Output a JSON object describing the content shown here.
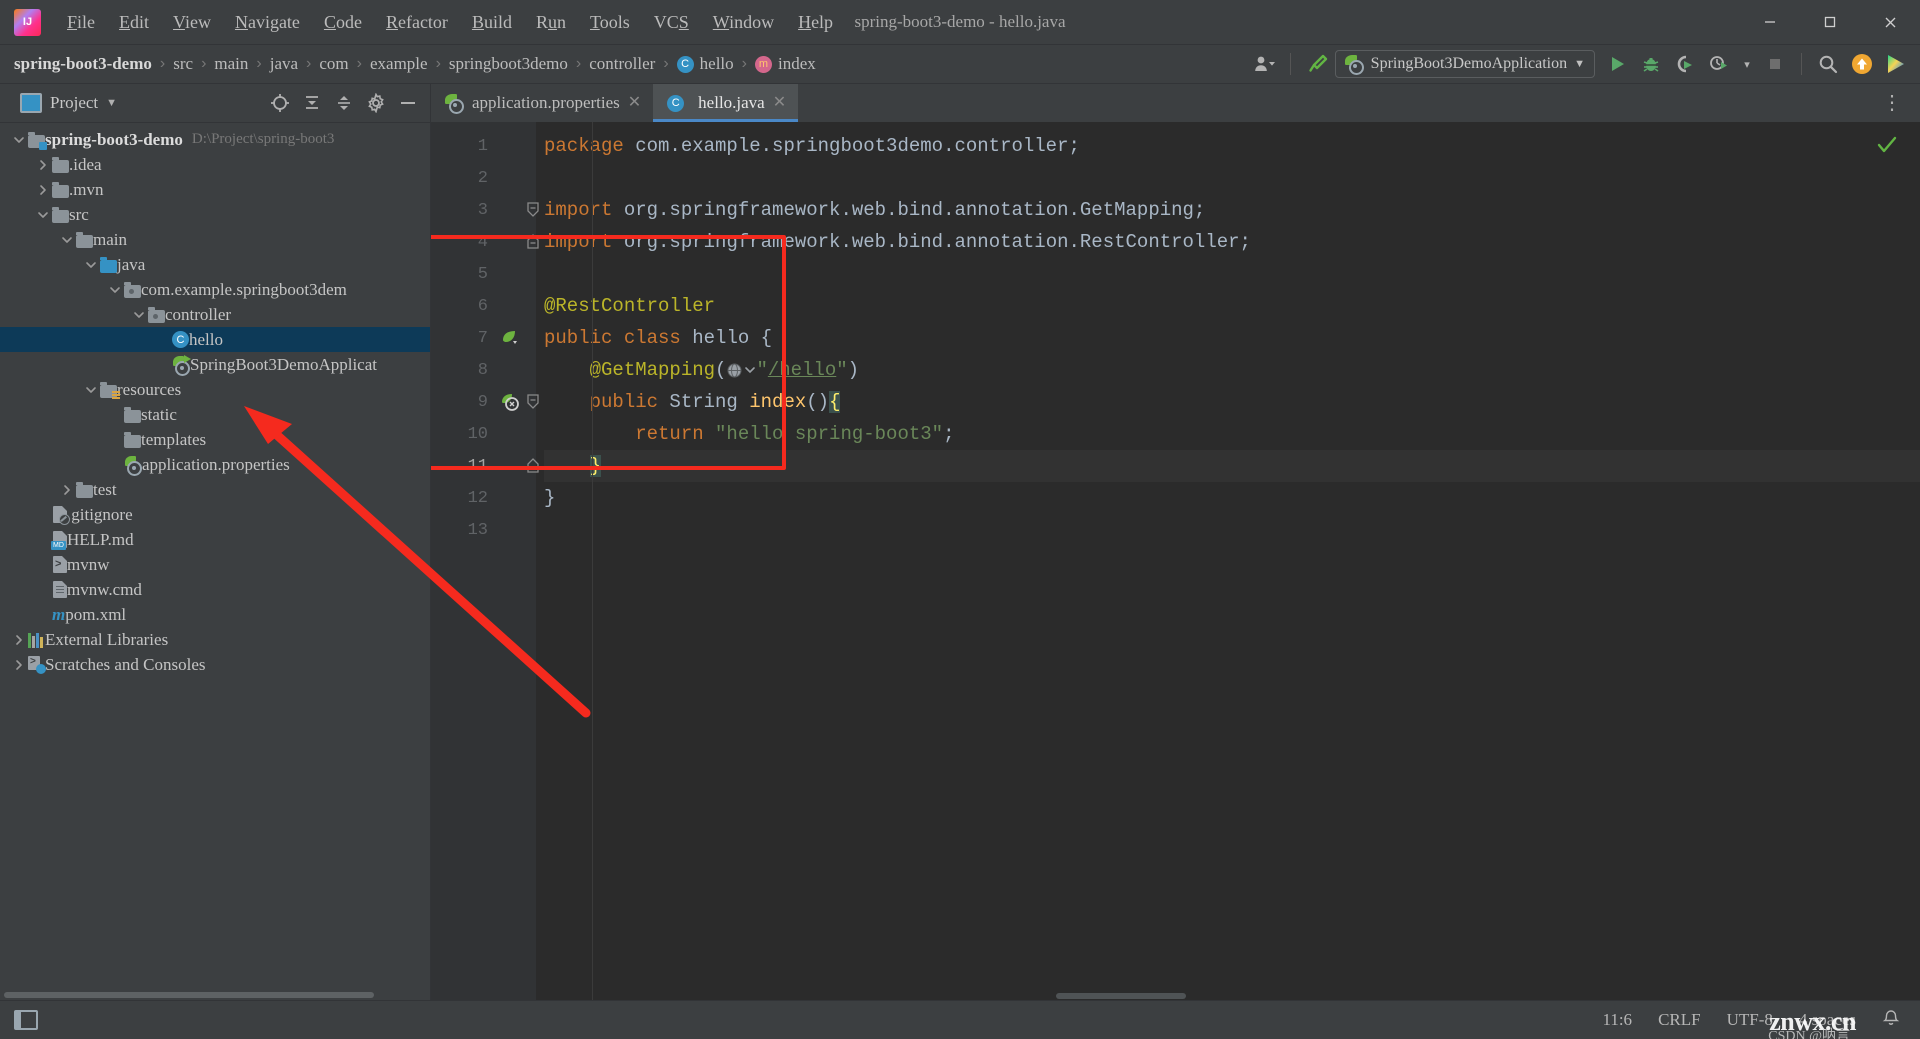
{
  "window": {
    "title": "spring-boot3-demo - hello.java",
    "logo_icon": "intellij-idea-logo",
    "minimize_label": "—",
    "maximize_label": "❐",
    "close_label": "✕"
  },
  "menubar": {
    "items": [
      {
        "label": "File",
        "mnemonic": "F"
      },
      {
        "label": "Edit",
        "mnemonic": "E"
      },
      {
        "label": "View",
        "mnemonic": "V"
      },
      {
        "label": "Navigate",
        "mnemonic": "N"
      },
      {
        "label": "Code",
        "mnemonic": "C"
      },
      {
        "label": "Refactor",
        "mnemonic": "R"
      },
      {
        "label": "Build",
        "mnemonic": "B"
      },
      {
        "label": "Run",
        "mnemonic": "u"
      },
      {
        "label": "Tools",
        "mnemonic": "T"
      },
      {
        "label": "VCS",
        "mnemonic": "S"
      },
      {
        "label": "Window",
        "mnemonic": "W"
      },
      {
        "label": "Help",
        "mnemonic": "H"
      }
    ]
  },
  "breadcrumb": {
    "separator": "›",
    "items": [
      {
        "label": "spring-boot3-demo",
        "icon": "none",
        "root": true
      },
      {
        "label": "src",
        "icon": "none"
      },
      {
        "label": "main",
        "icon": "none"
      },
      {
        "label": "java",
        "icon": "none"
      },
      {
        "label": "com",
        "icon": "none"
      },
      {
        "label": "example",
        "icon": "none"
      },
      {
        "label": "springboot3demo",
        "icon": "none"
      },
      {
        "label": "controller",
        "icon": "none"
      },
      {
        "label": "hello",
        "icon": "class-icon",
        "icon_letter": "C"
      },
      {
        "label": "index",
        "icon": "method-icon",
        "icon_letter": "m"
      }
    ]
  },
  "toolbar": {
    "account_icon": "user-account-icon",
    "build_icon": "build-hammer-icon",
    "run_config": {
      "icon": "spring-boot-icon",
      "label": "SpringBoot3DemoApplication",
      "chevron": "▼"
    },
    "run_icon": "run-play-icon",
    "debug_icon": "debug-bug-icon",
    "run_coverage_icon": "run-with-coverage-icon",
    "profiler_icon": "profiler-icon",
    "profiler_chevron": "▾",
    "stop_icon": "stop-square-icon",
    "search_icon": "search-everywhere-icon",
    "update_icon": "update-available-icon",
    "ai_icon": "ide-features-trainer-icon"
  },
  "sidebar": {
    "title": "Project",
    "title_chevron": "▼",
    "actions": [
      {
        "name": "select-opened-file-icon",
        "glyph": "⊕"
      },
      {
        "name": "expand-all-icon",
        "glyph": "⥣"
      },
      {
        "name": "collapse-all-icon",
        "glyph": "⥤"
      },
      {
        "name": "settings-gear-icon",
        "glyph": "⚙"
      },
      {
        "name": "hide-panel-icon",
        "glyph": "—"
      }
    ],
    "tree": [
      {
        "label": "spring-boot3-demo",
        "sub": "D:\\Project\\spring-boot3",
        "depth": 0,
        "twisty": "down",
        "icon": "module-folder-icon",
        "bold": true,
        "selected": false
      },
      {
        "label": ".idea",
        "sub": "",
        "depth": 1,
        "twisty": "right",
        "icon": "folder-icon",
        "bold": false,
        "selected": false
      },
      {
        "label": ".mvn",
        "sub": "",
        "depth": 1,
        "twisty": "right",
        "icon": "folder-icon",
        "bold": false,
        "selected": false
      },
      {
        "label": "src",
        "sub": "",
        "depth": 1,
        "twisty": "down",
        "icon": "folder-icon",
        "bold": false,
        "selected": false
      },
      {
        "label": "main",
        "sub": "",
        "depth": 2,
        "twisty": "down",
        "icon": "folder-icon",
        "bold": false,
        "selected": false
      },
      {
        "label": "java",
        "sub": "",
        "depth": 3,
        "twisty": "down",
        "icon": "source-folder-icon",
        "bold": false,
        "selected": false
      },
      {
        "label": "com.example.springboot3dem",
        "sub": "",
        "depth": 4,
        "twisty": "down",
        "icon": "package-icon",
        "bold": false,
        "selected": false
      },
      {
        "label": "controller",
        "sub": "",
        "depth": 5,
        "twisty": "down",
        "icon": "package-icon",
        "bold": false,
        "selected": false
      },
      {
        "label": "hello",
        "sub": "",
        "depth": 6,
        "twisty": "none",
        "icon": "java-class-icon",
        "bold": false,
        "selected": true
      },
      {
        "label": "SpringBoot3DemoApplicat",
        "sub": "",
        "depth": 6,
        "twisty": "none",
        "icon": "spring-boot-run-icon",
        "bold": false,
        "selected": false
      },
      {
        "label": "resources",
        "sub": "",
        "depth": 3,
        "twisty": "down",
        "icon": "resource-folder-icon",
        "bold": false,
        "selected": false
      },
      {
        "label": "static",
        "sub": "",
        "depth": 4,
        "twisty": "none",
        "icon": "folder-icon",
        "bold": false,
        "selected": false
      },
      {
        "label": "templates",
        "sub": "",
        "depth": 4,
        "twisty": "none",
        "icon": "folder-icon",
        "bold": false,
        "selected": false
      },
      {
        "label": "application.properties",
        "sub": "",
        "depth": 4,
        "twisty": "none",
        "icon": "spring-properties-icon",
        "bold": false,
        "selected": false
      },
      {
        "label": "test",
        "sub": "",
        "depth": 2,
        "twisty": "right",
        "icon": "folder-icon",
        "bold": false,
        "selected": false
      },
      {
        "label": ".gitignore",
        "sub": "",
        "depth": 1,
        "twisty": "none",
        "icon": "gitignore-file-icon",
        "bold": false,
        "selected": false
      },
      {
        "label": "HELP.md",
        "sub": "",
        "depth": 1,
        "twisty": "none",
        "icon": "markdown-file-icon",
        "bold": false,
        "selected": false
      },
      {
        "label": "mvnw",
        "sub": "",
        "depth": 1,
        "twisty": "none",
        "icon": "shell-script-icon",
        "bold": false,
        "selected": false
      },
      {
        "label": "mvnw.cmd",
        "sub": "",
        "depth": 1,
        "twisty": "none",
        "icon": "cmd-file-icon",
        "bold": false,
        "selected": false
      },
      {
        "label": "pom.xml",
        "sub": "",
        "depth": 1,
        "twisty": "none",
        "icon": "maven-file-icon",
        "bold": false,
        "selected": false
      },
      {
        "label": "External Libraries",
        "sub": "",
        "depth": 0,
        "twisty": "right",
        "icon": "external-libraries-icon",
        "bold": false,
        "selected": false
      },
      {
        "label": "Scratches and Consoles",
        "sub": "",
        "depth": 0,
        "twisty": "right",
        "icon": "scratches-icon",
        "bold": false,
        "selected": false
      }
    ]
  },
  "tabs": [
    {
      "label": "application.properties",
      "icon": "spring-properties-icon",
      "active": false,
      "close": "✕"
    },
    {
      "label": "hello.java",
      "icon": "java-class-icon",
      "icon_letter": "C",
      "active": true,
      "close": "✕"
    }
  ],
  "editor": {
    "kebab": "⋮",
    "inspection_status_icon": "inspections-ok-icon",
    "inspection_status_glyph": "✓",
    "lines": [
      {
        "num": "1",
        "marker": "",
        "fold": "",
        "highlight": false,
        "tokens": [
          {
            "t": "package ",
            "c": "kw"
          },
          {
            "t": "com.example.springboot3demo.controller;",
            "c": "plain"
          }
        ]
      },
      {
        "num": "2",
        "marker": "",
        "fold": "",
        "highlight": false,
        "tokens": []
      },
      {
        "num": "3",
        "marker": "",
        "fold": "fold-collapse",
        "highlight": false,
        "tokens": [
          {
            "t": "import ",
            "c": "kw"
          },
          {
            "t": "org.springframework.web.bind.annotation.GetMapping;",
            "c": "plain"
          }
        ]
      },
      {
        "num": "4",
        "marker": "",
        "fold": "fold-end",
        "highlight": false,
        "tokens": [
          {
            "t": "import ",
            "c": "kw"
          },
          {
            "t": "org.springframework.web.bind.annotation.RestController;",
            "c": "plain"
          }
        ]
      },
      {
        "num": "5",
        "marker": "",
        "fold": "",
        "highlight": false,
        "tokens": []
      },
      {
        "num": "6",
        "marker": "",
        "fold": "",
        "highlight": false,
        "tokens": [
          {
            "t": "@RestController",
            "c": "ann"
          }
        ]
      },
      {
        "num": "7",
        "marker": "spring-bean-gutter-icon",
        "fold": "",
        "highlight": false,
        "tokens": [
          {
            "t": "public ",
            "c": "kw"
          },
          {
            "t": "class ",
            "c": "kw"
          },
          {
            "t": "hello ",
            "c": "plain"
          },
          {
            "t": "{",
            "c": "plain"
          }
        ]
      },
      {
        "num": "8",
        "marker": "",
        "fold": "",
        "highlight": false,
        "tokens": [
          {
            "t": "    @GetMapping",
            "c": "ann"
          },
          {
            "t": "(",
            "c": "plain"
          },
          {
            "t": "@WEB@",
            "c": "webicon"
          },
          {
            "t": "\"",
            "c": "str"
          },
          {
            "t": "/hello",
            "c": "url"
          },
          {
            "t": "\"",
            "c": "str"
          },
          {
            "t": ")",
            "c": "plain"
          }
        ]
      },
      {
        "num": "9",
        "marker": "spring-request-mapping-gutter-icon",
        "fold": "fold-collapse",
        "highlight": false,
        "tokens": [
          {
            "t": "    public ",
            "c": "kw"
          },
          {
            "t": "String ",
            "c": "typ"
          },
          {
            "t": "index",
            "c": "mth"
          },
          {
            "t": "()",
            "c": "plain"
          },
          {
            "t": "{",
            "c": "brace-hl"
          }
        ]
      },
      {
        "num": "10",
        "marker": "",
        "fold": "",
        "highlight": false,
        "tokens": [
          {
            "t": "        return ",
            "c": "kw"
          },
          {
            "t": "\"hello spring-boot3\"",
            "c": "str"
          },
          {
            "t": ";",
            "c": "plain"
          }
        ]
      },
      {
        "num": "11",
        "marker": "",
        "fold": "fold-end",
        "highlight": true,
        "tokens": [
          {
            "t": "    ",
            "c": "plain"
          },
          {
            "t": "}",
            "c": "brace-hl"
          }
        ]
      },
      {
        "num": "12",
        "marker": "",
        "fold": "",
        "highlight": false,
        "tokens": [
          {
            "t": "}",
            "c": "plain"
          }
        ]
      },
      {
        "num": "13",
        "marker": "",
        "fold": "",
        "highlight": false,
        "tokens": []
      }
    ]
  },
  "annotation": {
    "highlight_rect_color": "#f52a1e",
    "arrow_color": "#f52a1e",
    "arrow_name": "red-pointer-arrow"
  },
  "statusbar": {
    "layout_icon": "toggle-tool-windows-icon",
    "caret_position": "11:6",
    "line_separator": "CRLF",
    "encoding": "UTF-8",
    "indent": "4 spaces",
    "bell_icon": "notifications-bell-icon",
    "bell_glyph": "🔔",
    "watermark": "znwx.cn",
    "watermark_sub": "CSDN @呐言"
  }
}
